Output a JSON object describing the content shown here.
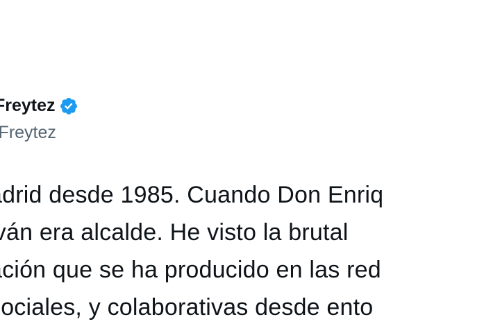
{
  "tweet": {
    "author": {
      "display_name": "Freytez",
      "handle": "iFreytez",
      "verified_icon": "verified-badge-icon",
      "verified_color": "#1d9bf0"
    },
    "text_lines": [
      "adrid desde 1985. Cuando Don Enriq",
      "lván era alcalde. He visto la brutal",
      "ación que se ha producido en las red",
      " sociales, y colaborativas desde ento"
    ]
  }
}
